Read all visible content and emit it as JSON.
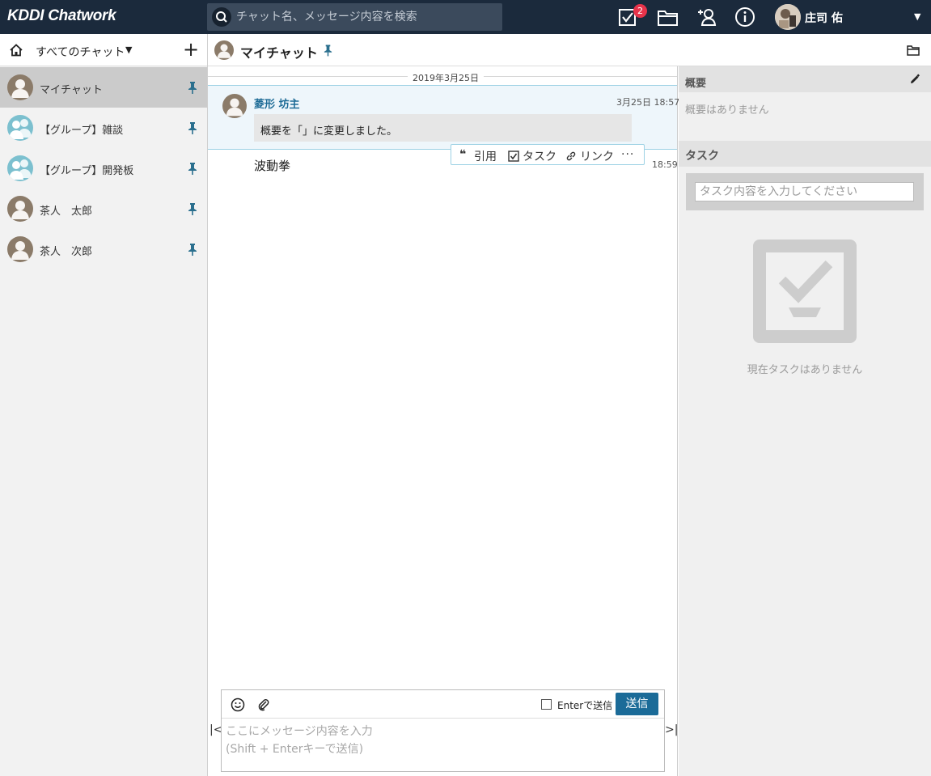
{
  "header": {
    "logo": "KDDI Chatwork",
    "search_placeholder": "チャット名、メッセージ内容を検索",
    "task_badge": "2",
    "user_name": "庄司 佑",
    "icons": [
      "search-icon",
      "task-icon",
      "folder-icon",
      "add-contact-icon",
      "info-icon",
      "avatar",
      "caret-down-icon"
    ]
  },
  "sidebar": {
    "filter_label": "すべてのチャット",
    "rooms": [
      {
        "name": "マイチャット",
        "active": true
      },
      {
        "name": "【グループ】雑談",
        "active": false
      },
      {
        "name": "【グループ】開発板",
        "active": false
      },
      {
        "name": "茶人　太郎",
        "active": false
      },
      {
        "name": "茶人　次郎",
        "active": false
      }
    ]
  },
  "room": {
    "title": "マイチャット"
  },
  "timeline": {
    "date_label": "2019年3月25日",
    "messages": [
      {
        "author": "菱形 坊主",
        "time": "3月25日 18:57",
        "body": "概要を「」に変更しました。"
      },
      {
        "body": "波動拳",
        "time": "18:59"
      }
    ],
    "actions": {
      "quote": "引用",
      "task": "タスク",
      "link": "リンク",
      "more": "···"
    }
  },
  "composer": {
    "enter_label": "Enterで送信",
    "send_label": "送信",
    "placeholder": "ここにメッセージ内容を入力\n(Shift + Enterキーで送信)"
  },
  "right_panel": {
    "summary_title": "概要",
    "summary_text": "概要はありません",
    "task_title": "タスク",
    "task_placeholder": "タスク内容を入力してください",
    "task_empty": "現在タスクはありません"
  },
  "colors": {
    "header_bg": "#1b2a3c",
    "accent": "#1b6b98",
    "badge": "#e8334a",
    "pin": "#2a6f8e"
  }
}
